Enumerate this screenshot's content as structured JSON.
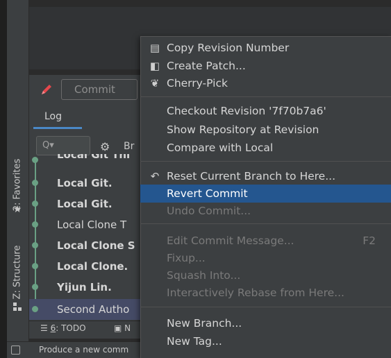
{
  "side_tabs": {
    "favorites": "2: Favorites",
    "structure": "Z: Structure"
  },
  "toolbar": {
    "commit_label": "Commit"
  },
  "log": {
    "tab_label": "Log",
    "search_placeholder": "Q▾",
    "branch_filter_label": "Br"
  },
  "commits": [
    {
      "message": "Local Git Thi",
      "bold": true
    },
    {
      "message": "Local Git.",
      "bold": true
    },
    {
      "message": "Local Git.",
      "bold": true
    },
    {
      "message": "Local Clone T",
      "bold": false
    },
    {
      "message": "Local Clone S",
      "bold": true
    },
    {
      "message": "Local Clone.",
      "bold": true
    },
    {
      "message": "Yijun Lin.",
      "bold": true
    },
    {
      "message": "Second Autho",
      "bold": false,
      "selected": true
    }
  ],
  "bottom_bar": {
    "todo_number": "6",
    "todo_label": ": TODO",
    "n_label": "N"
  },
  "status_bar": {
    "text": "Produce a new comm"
  },
  "context_menu": {
    "copy_revision": "Copy Revision Number",
    "create_patch": "Create Patch...",
    "cherry_pick": "Cherry-Pick",
    "checkout_revision": "Checkout Revision '7f70b7a6'",
    "show_repository": "Show Repository at Revision",
    "compare_local": "Compare with Local",
    "reset_branch": "Reset Current Branch to Here...",
    "revert_commit": "Revert Commit",
    "undo_commit": "Undo Commit...",
    "edit_message": "Edit Commit Message...",
    "edit_message_shortcut": "F2",
    "fixup": "Fixup...",
    "squash_into": "Squash Into...",
    "interactive_rebase": "Interactively Rebase from Here...",
    "new_branch": "New Branch...",
    "new_tag": "New Tag..."
  },
  "colors": {
    "menu_highlight": "#24568f",
    "graph": "#6aa084",
    "selected_row": "#454b66",
    "log_tab_underline": "#4a88c7"
  }
}
